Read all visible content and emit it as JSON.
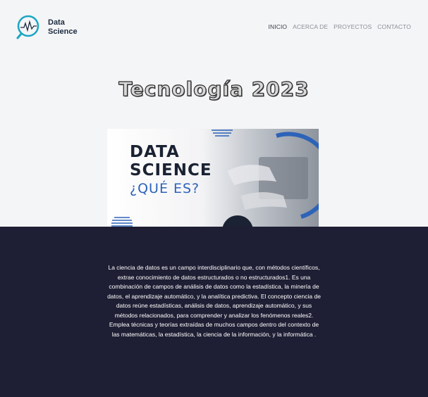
{
  "brand": {
    "line1": "Data",
    "line2": "Science",
    "accent_color": "#1aa6c4"
  },
  "nav": {
    "items": [
      {
        "label": "INICIO",
        "active": true
      },
      {
        "label": "ACERCA DE",
        "active": false
      },
      {
        "label": "PROYECTOS",
        "active": false
      },
      {
        "label": "CONTACTO",
        "active": false
      }
    ]
  },
  "main": {
    "title": "Tecnología 2023",
    "hero": {
      "line1": "DATA",
      "line2": "SCIENCE",
      "line3": "¿QUÉ ES?"
    }
  },
  "content": {
    "description": "La ciencia de datos es un campo interdisciplinario que, con métodos científicos, extrae conocimiento de datos estructurados o no estructurados1. Es una combinación de campos de análisis de datos como la estadística, la minería de datos, el aprendizaje automático, y la analítica predictiva. El concepto ciencia de datos reúne estadísticas, análisis de datos, aprendizaje automático, y sus métodos relacionados, para comprender y analizar los fenómenos reales2. Emplea técnicas y teorías extraídas de muchos campos dentro del contexto de las matemáticas, la estadística, la ciencia de la información, y la informática ."
  },
  "colors": {
    "dark_section": "#1e1e34",
    "page_bg": "#f4f5f7",
    "hero_blue": "#2d63b8"
  }
}
